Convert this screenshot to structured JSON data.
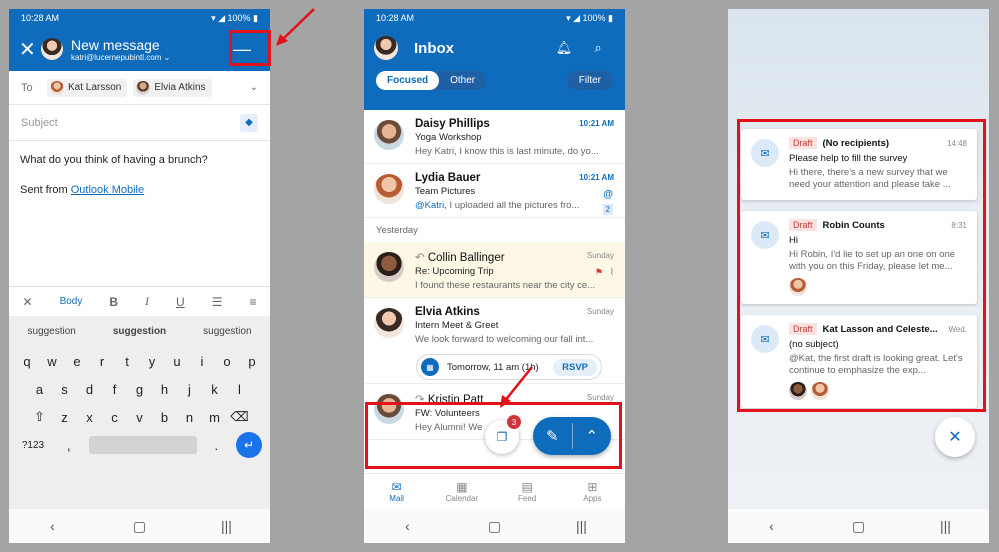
{
  "status": {
    "time": "10:28 AM",
    "battery": "100%"
  },
  "compose": {
    "title": "New message",
    "from": "katri@lucernepubintl.com",
    "to_label": "To",
    "recipients": [
      "Kat Larsson",
      "Elvia Atkins"
    ],
    "subject_placeholder": "Subject",
    "body": "What do you think of having a brunch?",
    "sent_from": "Sent from ",
    "sent_link": "Outlook Mobile",
    "format_body": "Body",
    "suggestions": [
      "suggestion",
      "suggestion",
      "suggestion"
    ],
    "keys_row1": [
      "q",
      "w",
      "e",
      "r",
      "t",
      "y",
      "u",
      "i",
      "o",
      "p"
    ],
    "keys_row2": [
      "a",
      "s",
      "d",
      "f",
      "g",
      "h",
      "j",
      "k",
      "l"
    ],
    "keys_row3": [
      "z",
      "x",
      "c",
      "v",
      "b",
      "n",
      "m"
    ],
    "sym_key": "?123",
    "comma": ",",
    "period": "."
  },
  "inbox": {
    "title": "Inbox",
    "tab_focused": "Focused",
    "tab_other": "Other",
    "filter": "Filter",
    "yesterday": "Yesterday",
    "mails": [
      {
        "from": "Daisy Phillips",
        "subject": "Yoga Workshop",
        "preview": "Hey Katri, I know this is last minute, do yo...",
        "time": "10:21 AM"
      },
      {
        "from": "Lydia Bauer",
        "subject": "Team Pictures",
        "mention": "@Katri",
        "preview": ", I uploaded all the pictures fro...",
        "time": "10:21 AM",
        "count": "2"
      },
      {
        "from": "Collin Ballinger",
        "subject": "Re: Upcoming Trip",
        "preview": "I found these restaurants near the city ce...",
        "time": "Sunday"
      },
      {
        "from": "Elvia Atkins",
        "subject": "Intern Meet & Greet",
        "preview": "We look forward to welcoming our fall int...",
        "time": "Sunday"
      },
      {
        "from": "Kristin Patt",
        "subject": "FW: Volunteers",
        "preview": "Hey Alumni! We",
        "time": "Sunday"
      }
    ],
    "event": {
      "when": "Tomorrow, 11 am (1h)",
      "rsvp": "RSVP"
    },
    "drafts_badge": "3",
    "tabs": [
      "Mail",
      "Calendar",
      "Feed",
      "Apps"
    ]
  },
  "drafts": [
    {
      "tag": "Draft",
      "who": "(No recipients)",
      "time": "14:48",
      "subject": "Please help to fill the survey",
      "preview": "Hi there, there's a new survey that we need your attention and please take ..."
    },
    {
      "tag": "Draft",
      "who": "Robin Counts",
      "time": "8:31",
      "subject": "Hi",
      "preview": "Hi Robin, I'd lie to set up an one on one with you on this Friday, please let me..."
    },
    {
      "tag": "Draft",
      "who": "Kat Lasson and Celeste...",
      "time": "Wed.",
      "subject": "(no subject)",
      "preview": "@Kat, the first draft is looking great. Let's continue to emphasize the exp..."
    }
  ],
  "colors": {
    "brand": "#0f6cbd",
    "annotation": "#e3111a"
  }
}
